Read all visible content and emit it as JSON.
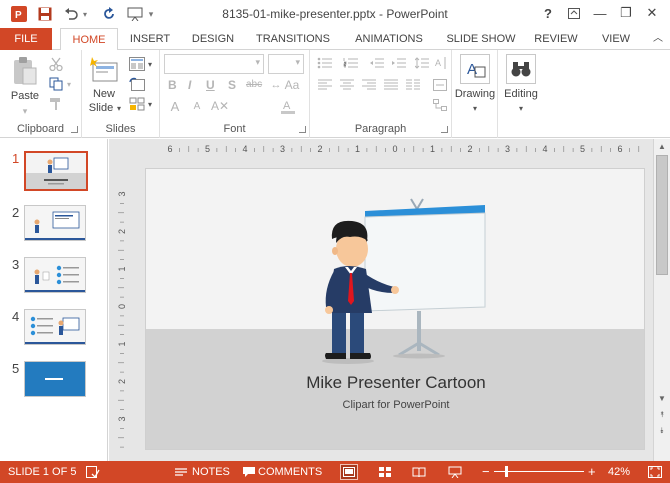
{
  "window": {
    "title": "8135-01-mike-presenter.pptx - PowerPoint",
    "help": "?",
    "controls": {
      "minimize": "—",
      "restore": "❐",
      "close": "✕"
    }
  },
  "tabs": [
    "FILE",
    "HOME",
    "INSERT",
    "DESIGN",
    "TRANSITIONS",
    "ANIMATIONS",
    "SLIDE SHOW",
    "REVIEW",
    "VIEW"
  ],
  "ribbon": {
    "clipboard": {
      "label": "Clipboard",
      "paste": "Paste"
    },
    "slides": {
      "label": "Slides",
      "new_slide_line1": "New",
      "new_slide_line2": "Slide"
    },
    "font": {
      "label": "Font",
      "bold": "B",
      "italic": "I",
      "underline": "U",
      "shadow": "S",
      "strike": "abc"
    },
    "paragraph": {
      "label": "Paragraph"
    },
    "drawing": {
      "label": "Drawing"
    },
    "editing": {
      "label": "Editing"
    }
  },
  "thumbnails": [
    {
      "number": "1"
    },
    {
      "number": "2"
    },
    {
      "number": "3"
    },
    {
      "number": "4"
    },
    {
      "number": "5"
    }
  ],
  "ruler": {
    "horizontal": [
      "6",
      "5",
      "4",
      "3",
      "2",
      "1",
      "0",
      "1",
      "2",
      "3",
      "4",
      "5",
      "6"
    ],
    "vertical": [
      "3",
      "2",
      "1",
      "0",
      "1",
      "2",
      "3"
    ]
  },
  "slide": {
    "title": "Mike Presenter Cartoon",
    "subtitle": "Clipart for PowerPoint"
  },
  "status": {
    "slide_info": "SLIDE 1 OF 5",
    "notes": "NOTES",
    "comments": "COMMENTS",
    "zoom_minus": "−",
    "zoom_plus": "+",
    "zoom": "42%"
  },
  "colors": {
    "accent": "#d24726",
    "brand_blue": "#2b579a"
  }
}
